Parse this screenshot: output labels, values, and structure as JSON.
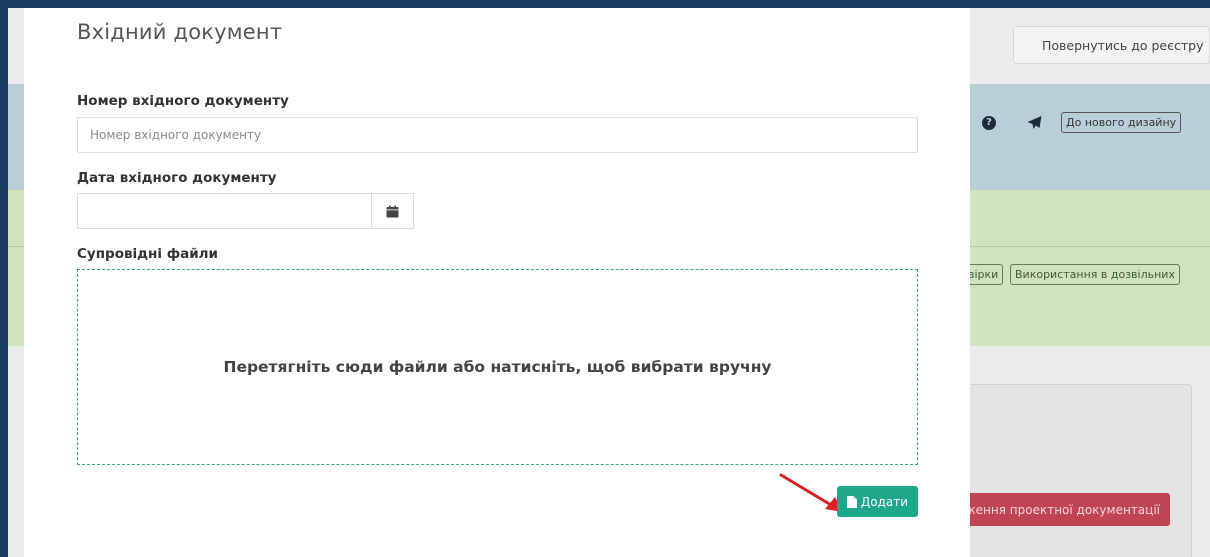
{
  "background": {
    "return_button": "Повернутись до реєстру",
    "new_design_button": "До нового дизайну",
    "chips": [
      "вірки",
      "Використання в дозвільних"
    ],
    "red_button": "ження проектної документації",
    "icons": [
      "question-circle-icon",
      "paper-plane-icon"
    ]
  },
  "modal": {
    "title": "Вхідний документ",
    "number_field": {
      "label": "Номер вхідного документу",
      "placeholder": "Номер вхідного документу",
      "value": ""
    },
    "date_field": {
      "label": "Дата вхідного документу",
      "value": "",
      "icon": "calendar-icon"
    },
    "files": {
      "label": "Супровідні файли",
      "dropzone_text": "Перетягніть сюди файли або натисніть, щоб вибрати вручну"
    },
    "add_button": {
      "label": "Додати",
      "icon": "file-icon",
      "color": "#1ea889"
    }
  },
  "colors": {
    "frame": "#1c3d63",
    "accent_green": "#1ea889",
    "dropzone_border": "#3aa874",
    "annotation_arrow": "#e01f25",
    "danger": "#c14454"
  }
}
